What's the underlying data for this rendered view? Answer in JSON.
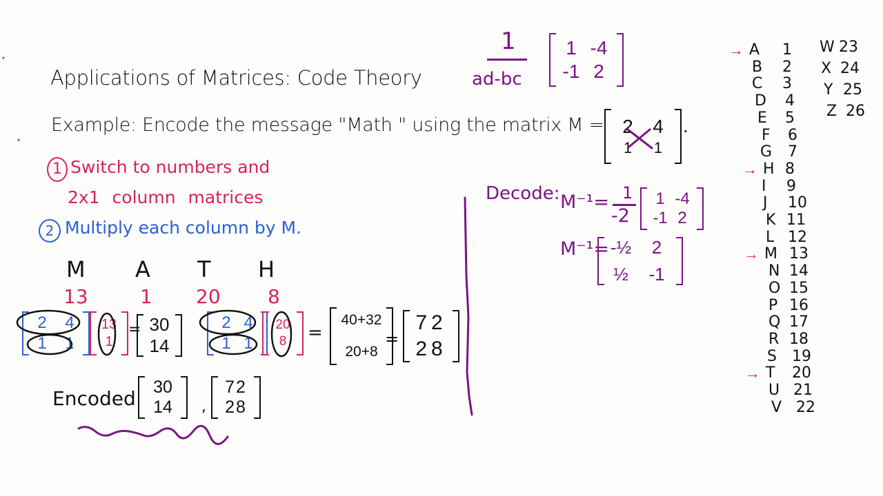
{
  "title": "Applications of Matrices: Code Theory",
  "example": "Example: Encode the message \"Math \" using the matrix M =",
  "matrix_M": [
    [
      "2",
      "4"
    ],
    [
      "1",
      "1"
    ]
  ],
  "matrix_M_trailing": ".",
  "inverse_formula": {
    "numerator": "1",
    "denominator": "ad-bc",
    "matrix": [
      [
        "1",
        "-4"
      ],
      [
        "-1",
        "2"
      ]
    ]
  },
  "steps": [
    {
      "number": "1",
      "line1": "Switch to numbers and",
      "line2": "2x1 column matrices",
      "color": "#d6245a"
    },
    {
      "number": "2",
      "line1": "Multiply each column by M.",
      "color": "#2b5fd9"
    }
  ],
  "message_letters": [
    "M",
    "A",
    "T",
    "H"
  ],
  "message_numbers": [
    "13",
    "1",
    "20",
    "8"
  ],
  "product1": {
    "M": [
      [
        "2",
        "4"
      ],
      [
        "1",
        "1"
      ]
    ],
    "column": [
      "13",
      "1"
    ],
    "equals": "=",
    "result": [
      "30",
      "14"
    ]
  },
  "product2": {
    "M": [
      [
        "2",
        "4"
      ],
      [
        "1",
        "1"
      ]
    ],
    "column": [
      "20",
      "8"
    ],
    "equals": "=",
    "expanded": [
      "40+32",
      "20+8"
    ],
    "result": [
      "72",
      "28"
    ]
  },
  "encoded": {
    "label": "Encoded",
    "matrices": [
      [
        "30",
        "14"
      ],
      [
        "72",
        "28"
      ]
    ],
    "separator": ","
  },
  "decode": {
    "label": "Decode:",
    "line1_lhs": "M⁻¹=",
    "line1_num": "1",
    "line1_den": "-2",
    "line1_matrix": [
      [
        "1",
        "-4"
      ],
      [
        "-1",
        "2"
      ]
    ],
    "line2_lhs": "M⁻¹=",
    "line2_matrix": [
      [
        "-½",
        "2"
      ],
      [
        "½",
        "-1"
      ]
    ]
  },
  "alphabet": [
    {
      "letter": "A",
      "num": "1",
      "arrow": true
    },
    {
      "letter": "B",
      "num": "2"
    },
    {
      "letter": "C",
      "num": "3"
    },
    {
      "letter": "D",
      "num": "4"
    },
    {
      "letter": "E",
      "num": "5"
    },
    {
      "letter": "F",
      "num": "6"
    },
    {
      "letter": "G",
      "num": "7"
    },
    {
      "letter": "H",
      "num": "8",
      "arrow": true
    },
    {
      "letter": "I",
      "num": "9"
    },
    {
      "letter": "J",
      "num": "10"
    },
    {
      "letter": "K",
      "num": "11"
    },
    {
      "letter": "L",
      "num": "12"
    },
    {
      "letter": "M",
      "num": "13",
      "arrow": true
    },
    {
      "letter": "N",
      "num": "14"
    },
    {
      "letter": "O",
      "num": "15"
    },
    {
      "letter": "P",
      "num": "16"
    },
    {
      "letter": "Q",
      "num": "17"
    },
    {
      "letter": "R",
      "num": "18"
    },
    {
      "letter": "S",
      "num": "19"
    },
    {
      "letter": "T",
      "num": "20",
      "arrow": true
    },
    {
      "letter": "U",
      "num": "21"
    },
    {
      "letter": "V",
      "num": "22"
    }
  ],
  "alphabet_col2": [
    {
      "letter": "W",
      "num": "23"
    },
    {
      "letter": "X",
      "num": "24"
    },
    {
      "letter": "Y",
      "num": "25"
    },
    {
      "letter": "Z",
      "num": "26"
    }
  ],
  "arrow_glyph": "→",
  "colors": {
    "red": "#d6245a",
    "blue": "#2b5fd9",
    "purple": "#7a1486",
    "ink": "#111111",
    "background": "#fdfdfb"
  }
}
